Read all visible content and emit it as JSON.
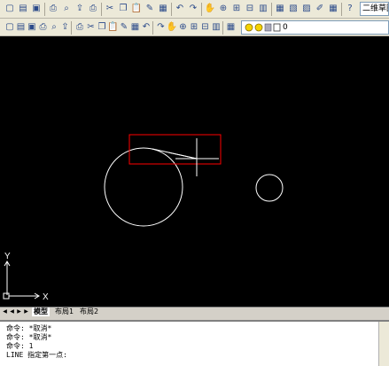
{
  "toolbar": {
    "workspace_label": "二维草图",
    "layer_value": "0",
    "tools_row1": [
      "new-icon",
      "open-icon",
      "save-icon",
      "print-icon",
      "plot-preview-icon",
      "publish-icon",
      "plot-icon",
      "cut-icon",
      "copy-icon",
      "paste-icon",
      "match-properties-icon",
      "block-editor-icon",
      "undo-icon",
      "redo-icon",
      "pan-icon",
      "zoom-realtime-icon",
      "zoom-window-icon",
      "zoom-previous-icon",
      "properties-icon",
      "design-center-icon",
      "tool-palettes-icon",
      "sheet-set-icon",
      "markup-icon",
      "calculator-icon",
      "help-icon"
    ],
    "tools_row2": [
      "line-icon",
      "construction-line-icon",
      "polyline-icon",
      "polygon-icon",
      "rectangle-icon",
      "arc-icon",
      "circle-icon",
      "revcloud-icon",
      "spline-icon",
      "ellipse-icon",
      "ellipse-arc-icon",
      "insert-block-icon",
      "make-block-icon",
      "point-icon",
      "hatch-icon",
      "gradient-icon",
      "region-icon",
      "table-icon",
      "mtext-icon",
      "layer-manager-icon"
    ]
  },
  "canvas": {
    "background": "#000000",
    "geometry_color": "#ffffff",
    "selection_color": "#ff0000",
    "ucs_x_label": "X",
    "ucs_y_label": "Y"
  },
  "tabs": {
    "model": "模型",
    "layout1": "布局1",
    "layout2": "布局2"
  },
  "command": {
    "lines": [
      "命令: *取消*",
      "命令: *取消*",
      "命令: 1",
      "LINE 指定第一点:"
    ]
  }
}
